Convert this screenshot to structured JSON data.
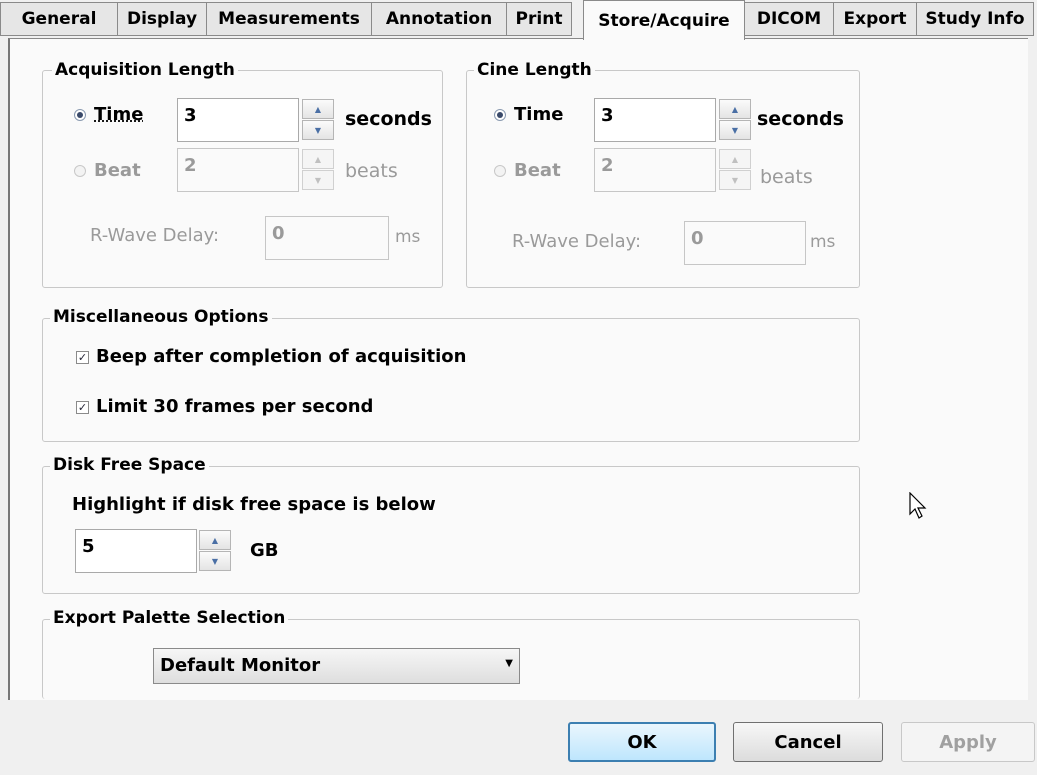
{
  "tabs": [
    {
      "label": "General"
    },
    {
      "label": "Display"
    },
    {
      "label": "Measurements"
    },
    {
      "label": "Annotation"
    },
    {
      "label": "Print"
    },
    {
      "label": "Store/Acquire"
    },
    {
      "label": "DICOM"
    },
    {
      "label": "Export"
    },
    {
      "label": "Study Info"
    }
  ],
  "active_tab": "Store/Acquire",
  "acquisition": {
    "title": "Acquisition Length",
    "time_label": "Time",
    "time_value": "3",
    "time_unit": "seconds",
    "beat_label": "Beat",
    "beat_value": "2",
    "beat_unit": "beats",
    "rwave_label": "R-Wave Delay:",
    "rwave_value": "0",
    "rwave_unit": "ms",
    "mode": "time"
  },
  "cine": {
    "title": "Cine Length",
    "time_label": "Time",
    "time_value": "3",
    "time_unit": "seconds",
    "beat_label": "Beat",
    "beat_value": "2",
    "beat_unit": "beats",
    "rwave_label": "R-Wave Delay:",
    "rwave_value": "0",
    "rwave_unit": "ms",
    "mode": "time"
  },
  "misc": {
    "title": "Miscellaneous Options",
    "beep_label": "Beep after completion of acquisition",
    "beep_checked": true,
    "limit_label": "Limit 30 frames per second",
    "limit_checked": true
  },
  "disk": {
    "title": "Disk Free Space",
    "highlight_label": "Highlight if disk free space is below",
    "value": "5",
    "unit": "GB"
  },
  "palette": {
    "title": "Export Palette Selection",
    "selected": "Default Monitor"
  },
  "buttons": {
    "ok": "OK",
    "cancel": "Cancel",
    "apply": "Apply"
  },
  "icons": {
    "spin_up": "spin-up-arrow-icon",
    "spin_down": "spin-down-arrow-icon",
    "dropdown": "chevron-down-icon",
    "cursor": "mouse-pointer-icon"
  }
}
